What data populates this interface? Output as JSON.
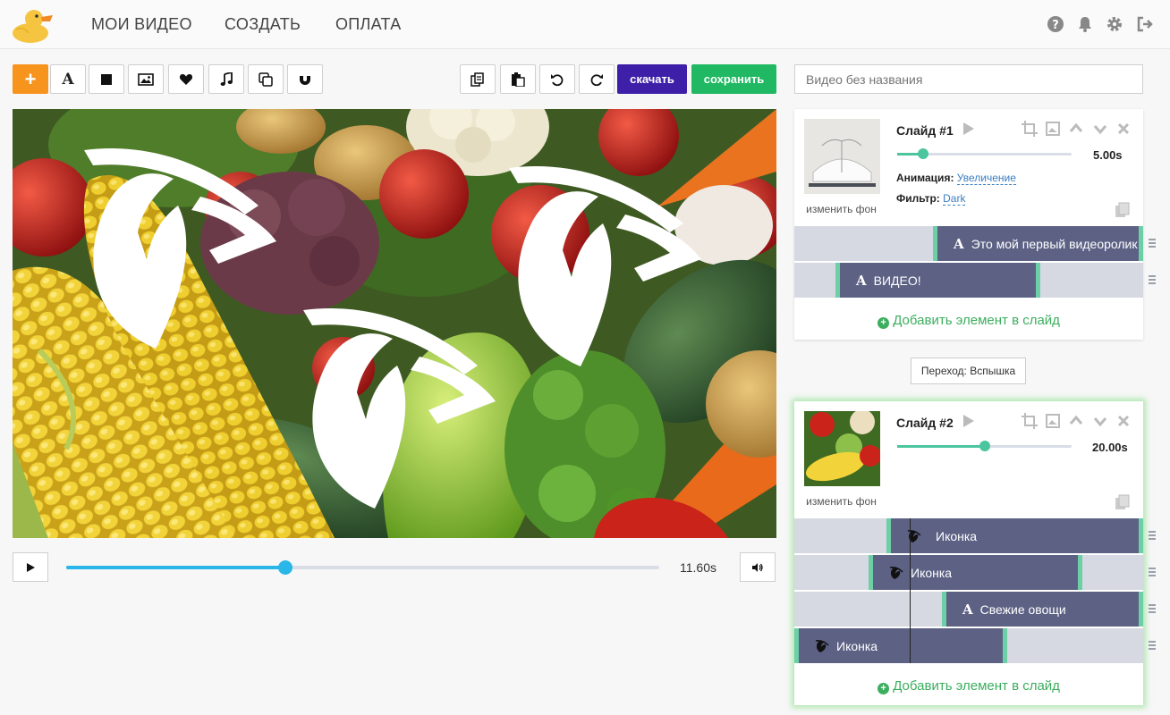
{
  "nav": {
    "items": [
      "МОИ ВИДЕО",
      "СОЗДАТЬ",
      "ОПЛАТА"
    ]
  },
  "header_icons": [
    "help-icon",
    "bell-icon",
    "gear-icon",
    "logout-icon"
  ],
  "toolbar": {
    "tools": [
      "add-icon",
      "text-icon",
      "square-icon",
      "image-icon",
      "heart-icon",
      "music-icon",
      "copy-icon",
      "magnet-icon"
    ],
    "edit_tools": [
      "duplicate-icon",
      "paste-icon",
      "undo-icon",
      "redo-icon"
    ],
    "download_label": "скачать",
    "save_label": "сохранить",
    "download_color": "#3d1fa8",
    "save_color": "#20b862"
  },
  "video_title": {
    "placeholder": "Видео без названия",
    "value": ""
  },
  "player": {
    "time": "11.60s",
    "progress": 0.37
  },
  "slides": [
    {
      "title": "Слайд #1",
      "duration": "5.00s",
      "duration_fraction": 0.15,
      "change_bg": "изменить фон",
      "animation_label": "Анимация:",
      "animation_value": "Увеличение",
      "filter_label": "Фильтр:",
      "filter_value": "Dark",
      "elements": [
        {
          "type": "text",
          "glyph": "A",
          "label": "Это мой первый видеоролик"
        },
        {
          "type": "text",
          "glyph": "A",
          "label": "ВИДЕО!"
        }
      ],
      "add_element": "Добавить элемент в слайд"
    },
    {
      "title": "Слайд #2",
      "duration": "20.00s",
      "duration_fraction": 0.5,
      "change_bg": "изменить фон",
      "elements": [
        {
          "type": "icon",
          "glyph": "leaf",
          "label": "Иконка"
        },
        {
          "type": "icon",
          "glyph": "leaf",
          "label": "Иконка"
        },
        {
          "type": "text",
          "glyph": "A",
          "label": "Свежие овощи"
        },
        {
          "type": "icon",
          "glyph": "leaf",
          "label": "Иконка"
        }
      ],
      "add_element": "Добавить элемент в слайд"
    }
  ],
  "transition": "Переход: Вспышка"
}
